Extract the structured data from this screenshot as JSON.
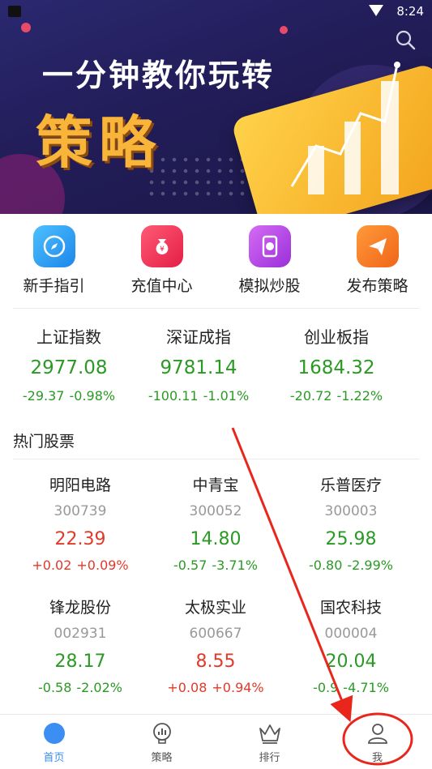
{
  "status": {
    "time": "8:24"
  },
  "banner": {
    "title": "一分钟教你玩转",
    "subtitle": "策略"
  },
  "menu": [
    {
      "label": "新手指引",
      "icon": "compass-icon",
      "color": "#2d9df2"
    },
    {
      "label": "充值中心",
      "icon": "money-bag-icon",
      "color": "#f03a5a"
    },
    {
      "label": "模拟炒股",
      "icon": "phone-chart-icon",
      "color": "#b647e6"
    },
    {
      "label": "发布策略",
      "icon": "paper-plane-icon",
      "color": "#f57a22"
    }
  ],
  "indices": [
    {
      "name": "上证指数",
      "value": "2977.08",
      "change": "-29.37",
      "pct": "-0.98%"
    },
    {
      "name": "深证成指",
      "value": "9781.14",
      "change": "-100.11",
      "pct": "-1.01%"
    },
    {
      "name": "创业板指",
      "value": "1684.32",
      "change": "-20.72",
      "pct": "-1.22%"
    }
  ],
  "hot_title": "热门股票",
  "stocks": [
    {
      "name": "明阳电路",
      "code": "300739",
      "price": "22.39",
      "change": "+0.02",
      "pct": "+0.09%",
      "trend": "up"
    },
    {
      "name": "中青宝",
      "code": "300052",
      "price": "14.80",
      "change": "-0.57",
      "pct": "-3.71%",
      "trend": "down"
    },
    {
      "name": "乐普医疗",
      "code": "300003",
      "price": "25.98",
      "change": "-0.80",
      "pct": "-2.99%",
      "trend": "down"
    },
    {
      "name": "锋龙股份",
      "code": "002931",
      "price": "28.17",
      "change": "-0.58",
      "pct": "-2.02%",
      "trend": "down"
    },
    {
      "name": "太极实业",
      "code": "600667",
      "price": "8.55",
      "change": "+0.08",
      "pct": "+0.94%",
      "trend": "up"
    },
    {
      "name": "国农科技",
      "code": "000004",
      "price": "20.04",
      "change": "-0.9",
      "pct": "-4.71%",
      "trend": "down"
    }
  ],
  "tabs": [
    {
      "label": "首页",
      "icon": "home-dot-icon",
      "active": true
    },
    {
      "label": "策略",
      "icon": "lightbulb-chart-icon",
      "active": false
    },
    {
      "label": "排行",
      "icon": "crown-icon",
      "active": false
    },
    {
      "label": "我",
      "icon": "person-icon",
      "active": false
    }
  ],
  "colors": {
    "up": "#e03a2a",
    "down": "#2a9a24",
    "accent": "#3c8ef3",
    "annotation": "#e8261c"
  }
}
